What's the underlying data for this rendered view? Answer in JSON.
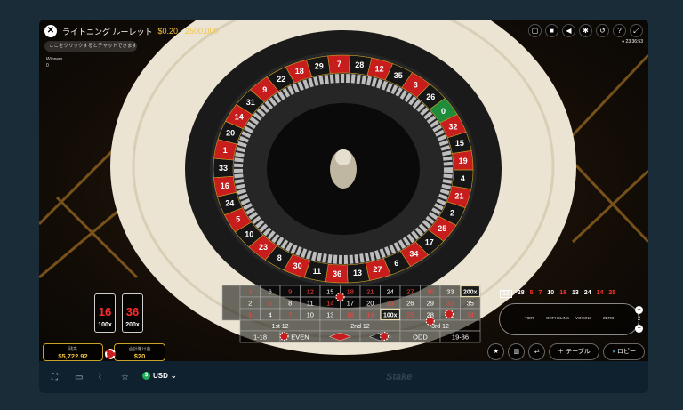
{
  "header": {
    "close_icon": "close-icon",
    "game_title": "ライトニング ルーレット",
    "limits": "$0.20 - 2500,000",
    "chat_placeholder": "ここをクリックするとチャットできます",
    "winners_label": "Winners",
    "winners_count": "0",
    "clock": "● 23:36:53"
  },
  "toolbar_icons": [
    "chat-icon",
    "video-icon",
    "volume-icon",
    "settings-icon",
    "history-icon",
    "help-icon",
    "fullscreen-icon"
  ],
  "wheel": {
    "numbers": [
      "0",
      "32",
      "15",
      "19",
      "4",
      "21",
      "2",
      "25",
      "17",
      "34",
      "6",
      "27",
      "13",
      "36",
      "11",
      "30",
      "8",
      "23",
      "10",
      "5",
      "24",
      "16",
      "33",
      "1",
      "20",
      "14",
      "31",
      "9",
      "22",
      "18",
      "29",
      "7",
      "28",
      "12",
      "35",
      "3",
      "26"
    ]
  },
  "lightning_multipliers": [
    {
      "number": "16",
      "multiplier": "100x"
    },
    {
      "number": "36",
      "multiplier": "200x"
    }
  ],
  "betting_board": {
    "row1": [
      "3",
      "6",
      "9",
      "12",
      "15",
      "18",
      "21",
      "24",
      "27",
      "30",
      "33",
      "36"
    ],
    "row2": [
      "2",
      "5",
      "8",
      "11",
      "14",
      "17",
      "20",
      "23",
      "26",
      "29",
      "32",
      "35"
    ],
    "row3": [
      "1",
      "4",
      "7",
      "10",
      "13",
      "16",
      "19",
      "22",
      "25",
      "28",
      "31",
      "34"
    ],
    "dozens": [
      "1st 12",
      "2nd 12",
      "3rd 12"
    ],
    "outside": [
      "1-18",
      "EVEN",
      "ODD",
      "19-36"
    ],
    "board_multipliers": [
      "100x",
      "200x"
    ]
  },
  "balance": {
    "label": "残高",
    "value": "$5,722.92"
  },
  "total_bet": {
    "label": "合計賭け金",
    "value": "$20"
  },
  "recent_results": {
    "current": "13",
    "items": [
      {
        "n": "28",
        "red": false
      },
      {
        "n": "5",
        "red": true
      },
      {
        "n": "7",
        "red": true
      },
      {
        "n": "10",
        "red": false
      },
      {
        "n": "18",
        "red": true
      },
      {
        "n": "13",
        "red": false
      },
      {
        "n": "24",
        "red": false
      },
      {
        "n": "14",
        "red": true
      },
      {
        "n": "25",
        "red": true
      }
    ]
  },
  "racetrack": {
    "labels": [
      "TIER",
      "ORPHELINS",
      "VOISINS",
      "ZERO"
    ],
    "neighbors": "2"
  },
  "actions": {
    "favourite_icon": "star-icon",
    "stats_icon": "stats-icon",
    "switch_icon": "swap-icon",
    "table_label": "テーブル",
    "lobby_label": "ロビー"
  },
  "bottom_bar": {
    "currency": "USD",
    "brand": "Stake"
  },
  "colors": {
    "red": "#c81d1d",
    "black": "#161616",
    "green": "#1e8c3a",
    "gold": "#c9a227"
  }
}
